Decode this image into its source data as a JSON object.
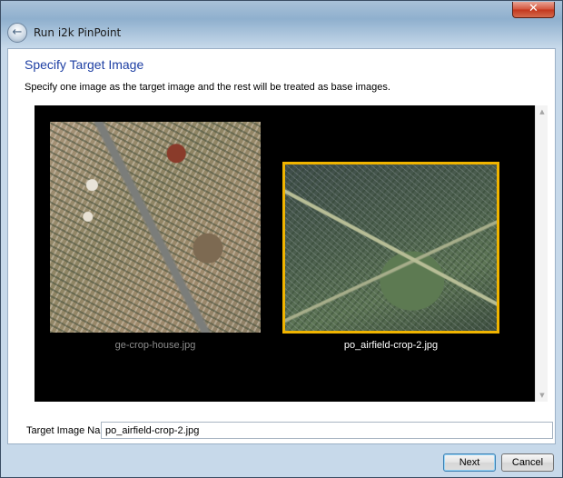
{
  "window": {
    "app_title": "Run i2k PinPoint",
    "close_glyph": "✕",
    "back_glyph": "←"
  },
  "page": {
    "title": "Specify Target Image",
    "instructions": "Specify one image as the target image and the rest will be treated as base images."
  },
  "images": [
    {
      "filename": "ge-crop-house.jpg",
      "selected": false
    },
    {
      "filename": "po_airfield-crop-2.jpg",
      "selected": true
    }
  ],
  "scrollbar": {
    "up_glyph": "▲",
    "down_glyph": "▼"
  },
  "target": {
    "label": "Target Image Name:",
    "value": "po_airfield-crop-2.jpg"
  },
  "footer": {
    "next_label": "Next",
    "cancel_label": "Cancel"
  },
  "colors": {
    "selection_border": "#f0b400",
    "title_blue": "#1e3fa3"
  }
}
